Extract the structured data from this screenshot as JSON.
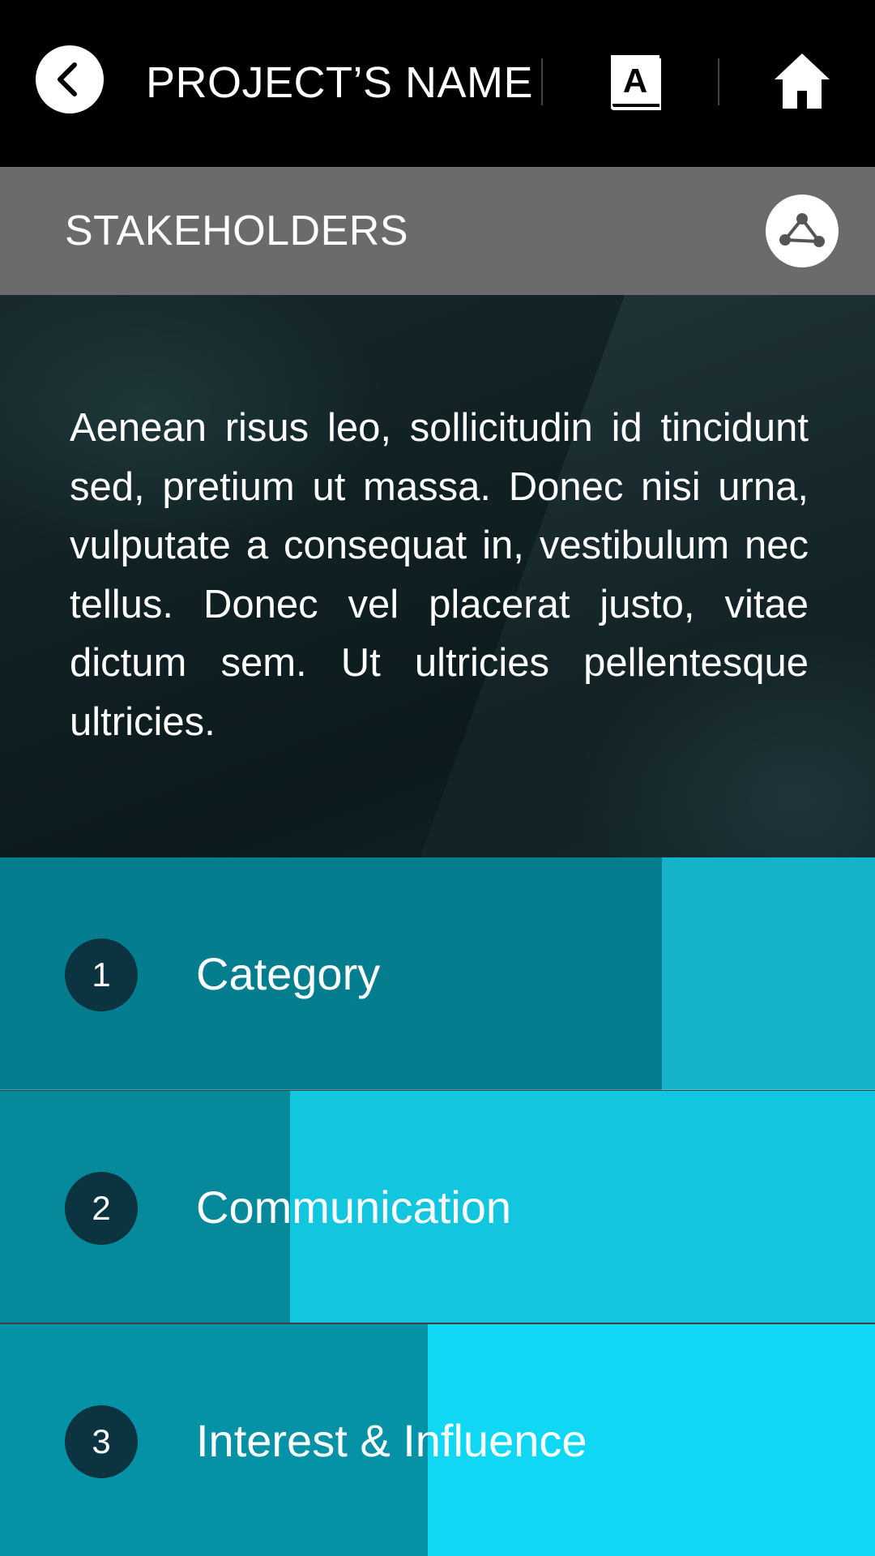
{
  "header": {
    "project_name": "PROJECT’S NAME",
    "back_icon": "chevron-left-icon",
    "dictionary_icon": "dictionary-icon",
    "home_icon": "home-icon"
  },
  "section": {
    "title": "STAKEHOLDERS",
    "network_icon": "network-icon"
  },
  "intro": {
    "text": "Aenean risus leo, sollicitudin id tincidunt sed, pretium ut massa. Donec nisi urna, vulputate a consequat in, vestibulum nec tellus. Donec vel placerat justo, vitae dictum sem. Ut ultricies pellentesque ultricies."
  },
  "menu": {
    "items": [
      {
        "number": "1",
        "label": "Category"
      },
      {
        "number": "2",
        "label": "Communication"
      },
      {
        "number": "3",
        "label": "Interest & Influence"
      }
    ]
  },
  "colors": {
    "header_bg": "#000000",
    "section_bar_bg": "#6b6b6b",
    "badge_bg": "#0b3440",
    "teal_dark": "#047e8e",
    "teal_light": "#10d8f4"
  }
}
